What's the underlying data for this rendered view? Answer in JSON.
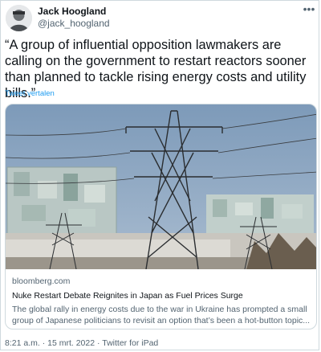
{
  "author": {
    "name": "Jack Hoogland",
    "handle": "@jack_hoogland"
  },
  "menu_icon": "more-options-icon",
  "tweet": {
    "text": "“A group of influential opposition lawmakers are calling on the government to restart reactors sooner than planned to tackle rising energy costs and utility bills.”",
    "translate_label": "Tweet vertalen"
  },
  "card": {
    "image_icon": "power-pylon-reactor-photo",
    "domain": "bloomberg.com",
    "title": "Nuke Restart Debate Reignites in Japan as Fuel Prices Surge",
    "description_line1": "The global rally in energy costs due to the war in Ukraine has prompted a small",
    "description_line2": "group of Japanese politicians to revisit an option that’s been a hot-button topic..."
  },
  "meta": {
    "time": "8:21 a.m.",
    "separator1": " · ",
    "date": "15 mrt. 2022",
    "separator2": " · ",
    "source": "Twitter for iPad"
  },
  "colors": {
    "link": "#1d9bf0",
    "secondary_text": "#536471",
    "border": "#cfd9de"
  }
}
